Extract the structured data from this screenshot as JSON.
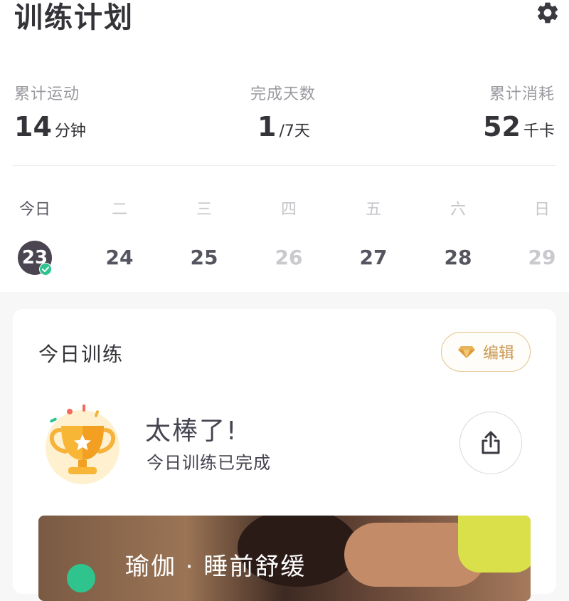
{
  "header": {
    "title": "训练计划",
    "settings_icon": "gear-icon"
  },
  "stats": [
    {
      "label": "累计运动",
      "value": "14",
      "unit": "分钟"
    },
    {
      "label": "完成天数",
      "value": "1",
      "unit": "/7天"
    },
    {
      "label": "累计消耗",
      "value": "52",
      "unit": "千卡"
    }
  ],
  "week": {
    "weekdays": [
      "今日",
      "二",
      "三",
      "四",
      "五",
      "六",
      "日"
    ],
    "dates": [
      "23",
      "24",
      "25",
      "26",
      "27",
      "28",
      "29"
    ],
    "today_completed": true
  },
  "today_card": {
    "title": "今日训练",
    "edit_label": "编辑",
    "message_title": "太棒了!",
    "message_subtitle": "今日训练已完成",
    "workout_title": "瑜伽 · 睡前舒缓"
  },
  "colors": {
    "accent_gold": "#c9964e",
    "today_circle": "#4a4550",
    "check_green": "#2fc48d"
  }
}
